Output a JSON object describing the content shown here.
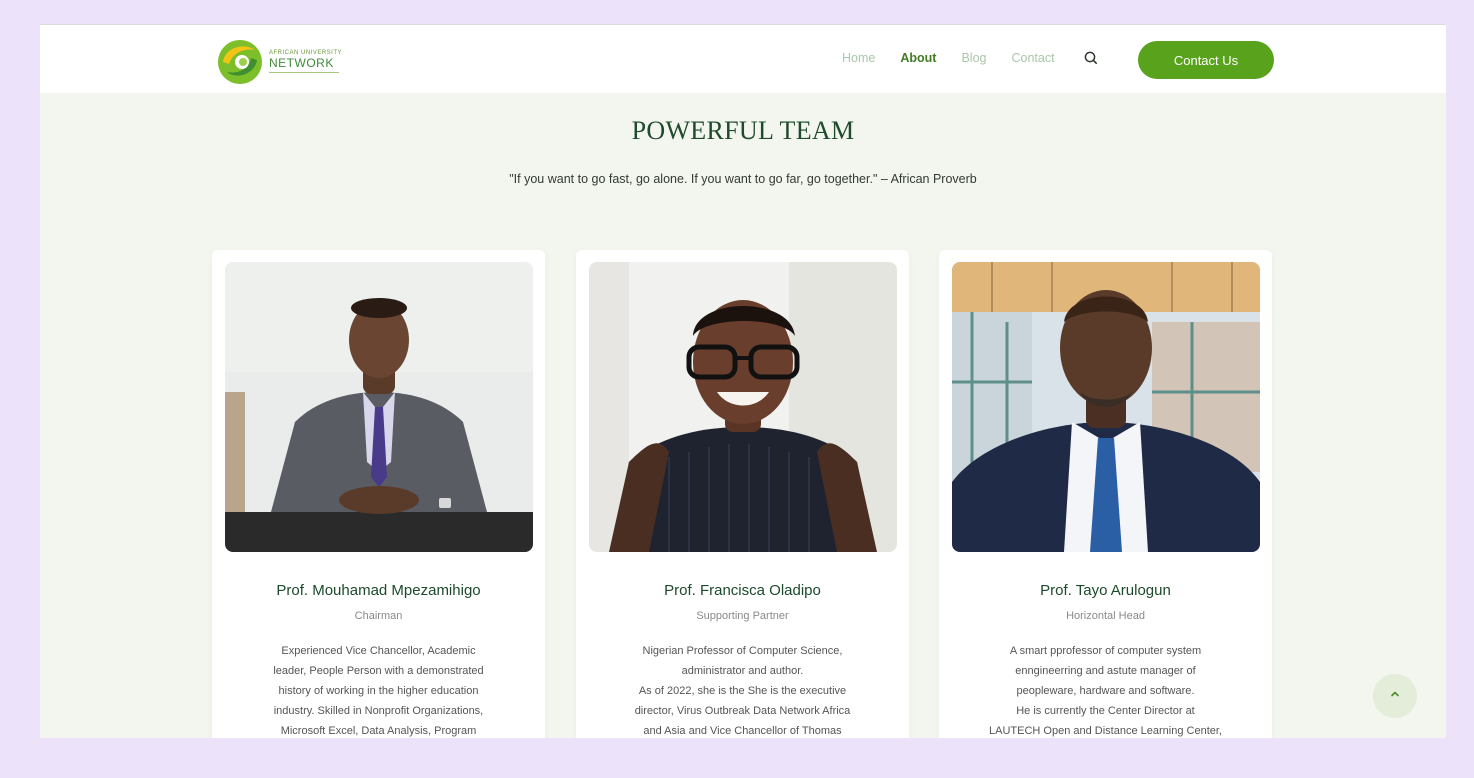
{
  "brand": {
    "logo_small": "AFRICAN UNIVERSITY",
    "logo_big": "NETWORK",
    "accent": "#58a21c",
    "dark_green": "#1f4a2b",
    "section_bg": "#f3f6ef"
  },
  "nav": {
    "items": [
      {
        "label": "Home",
        "active": false
      },
      {
        "label": "About",
        "active": true
      },
      {
        "label": "Blog",
        "active": false
      },
      {
        "label": "Contact",
        "active": false
      }
    ],
    "search_icon": "search-icon",
    "cta_label": "Contact Us"
  },
  "team": {
    "title": "POWERFUL TEAM",
    "quote": "\"If you want to go fast, go alone. If you want to go far, go together.\" – African Proverb",
    "members": [
      {
        "name": "Prof. Mouhamad Mpezamihigo",
        "role": "Chairman",
        "bio": [
          "Experienced Vice Chancellor, Academic",
          "leader, People Person with a demonstrated",
          "history of working in the higher education",
          "industry. Skilled in Nonprofit Organizations,",
          "Microsoft Excel, Data Analysis, Program"
        ]
      },
      {
        "name": "Prof. Francisca Oladipo",
        "role": "Supporting Partner",
        "bio": [
          "Nigerian Professor of Computer Science,",
          "administrator and author.",
          "As of 2022, she is the She is the executive",
          "director, Virus Outbreak Data Network Africa",
          "and Asia and Vice Chancellor of Thomas"
        ]
      },
      {
        "name": "Prof. Tayo Arulogun",
        "role": "Horizontal Head",
        "bio": [
          "A smart pprofessor of computer system",
          "enngineerring and astute manager of",
          "peopleware, hardware and software.",
          "He is currently the Center Director at",
          "LAUTECH Open and Distance Learning Center,"
        ]
      }
    ]
  },
  "scroll_top_icon": "chevron-up-icon"
}
